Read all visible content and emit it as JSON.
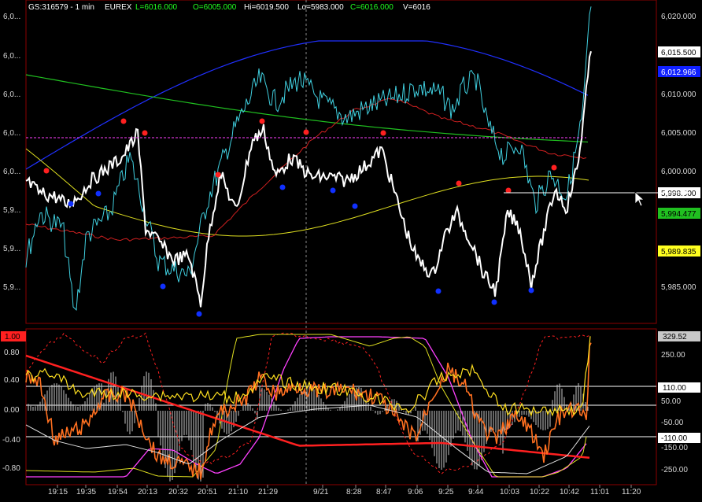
{
  "header": {
    "symbol": "GS:316579 - 1 min",
    "exchange": "EUREX",
    "low": "L=6016.000",
    "open": "O=6005.000",
    "high": "Hi=6019.500",
    "lo": "Lo=5983.000",
    "close": "C=6016.000",
    "volume": "V=6016"
  },
  "colors": {
    "price": "#ffffff",
    "close_cyan": "#40d0e0",
    "ma_blue": "#2030ff",
    "ma_green": "#20c020",
    "ma_yellow": "#e0e020",
    "ma_red": "#d02020",
    "dot_red": "#ff2020",
    "dot_blue": "#1030ff",
    "osc_yellow": "#ffe020",
    "osc_orange": "#ff7020",
    "osc_red_line": "#ff2020",
    "osc_magenta": "#ff40ff",
    "grid_red": "#8b0000"
  },
  "left_axis_top": {
    "labels": [
      "6,0...",
      "6,0...",
      "6,0...",
      "6,0...",
      "6,0...",
      "5,9...",
      "5,9...",
      "5,9..."
    ]
  },
  "right_axis_top": {
    "labels": [
      "6,020.000",
      "6,010.000",
      "6,005.000",
      "6,000.000",
      "5,985.000"
    ],
    "tags": {
      "last": "6,015.500",
      "blue": "6,012.966",
      "ref": "5,998.000",
      "green": "5,994.477",
      "yellow": "5,989.835"
    }
  },
  "left_axis_bottom": {
    "top_tag": "1.00",
    "labels": [
      "0.80",
      "0.40",
      "0.00",
      "-0.40",
      "-0.80"
    ]
  },
  "right_axis_bottom": {
    "labels": [
      "250.00",
      "-150.00",
      "-250.00"
    ],
    "tags": {
      "top": "329.52",
      "upper": "110.00",
      "mid": "50.00",
      "zero": "-50.00",
      "lower": "-110.00"
    }
  },
  "time_axis": {
    "labels": [
      "19:15",
      "19:35",
      "19:54",
      "20:13",
      "20:32",
      "20:51",
      "21:10",
      "21:29",
      "9/21",
      "8:28",
      "8:47",
      "9:06",
      "9:25",
      "9:44",
      "10:03",
      "10:22",
      "10:42",
      "11:01",
      "11:20"
    ]
  }
}
